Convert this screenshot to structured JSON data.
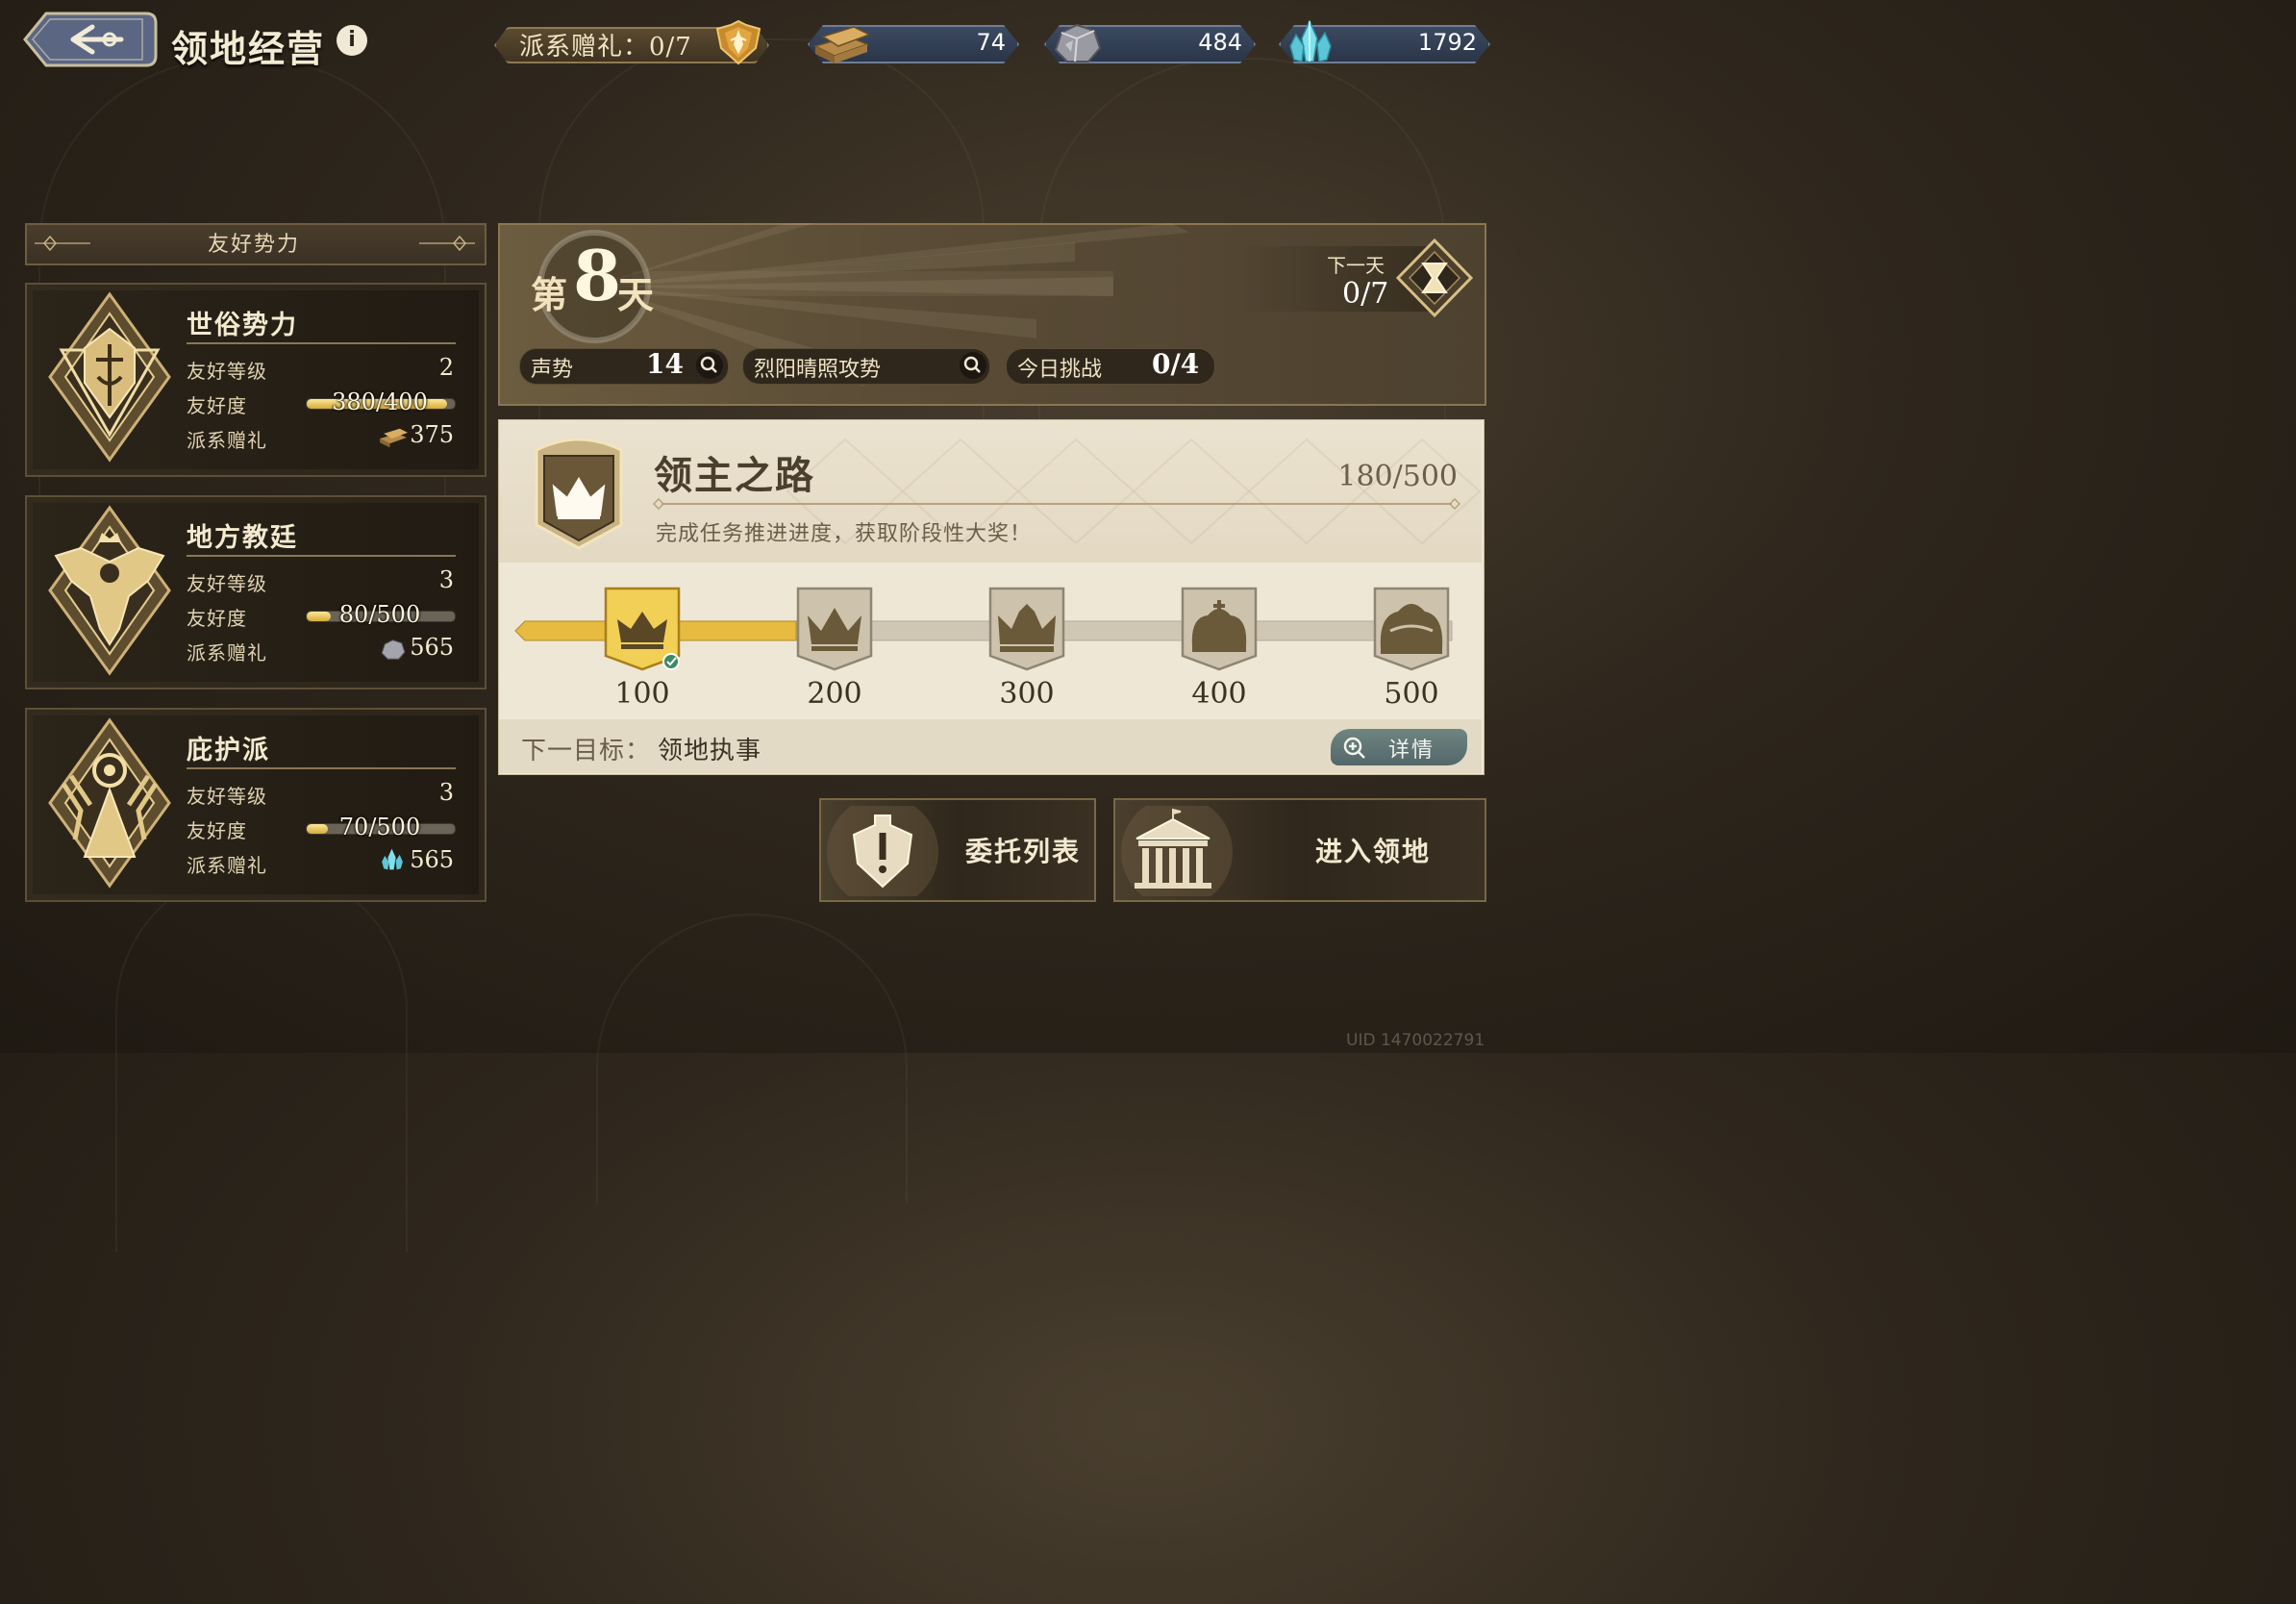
{
  "header": {
    "title": "领地经营",
    "info_label": "i",
    "faction_gift": "派系赠礼：0/7",
    "resources": [
      {
        "name": "wood",
        "icon": "wood-planks-icon",
        "value": "74"
      },
      {
        "name": "ore",
        "icon": "ore-rock-icon",
        "value": "484"
      },
      {
        "name": "crystal",
        "icon": "crystal-icon",
        "value": "1792"
      }
    ]
  },
  "factions": {
    "header": "友好势力",
    "labels": {
      "level": "友好等级",
      "friendship": "友好度",
      "gift": "派系赠礼"
    },
    "items": [
      {
        "name": "世俗势力",
        "level": "2",
        "friendship_text": "380/400",
        "friendship_progress": 0.95,
        "gift_icon": "wood-planks-icon",
        "gift_value": "375"
      },
      {
        "name": "地方教廷",
        "level": "3",
        "friendship_text": "80/500",
        "friendship_progress": 0.16,
        "gift_icon": "ore-rock-icon",
        "gift_value": "565"
      },
      {
        "name": "庇护派",
        "level": "3",
        "friendship_text": "70/500",
        "friendship_progress": 0.14,
        "gift_icon": "crystal-icon",
        "gift_value": "565"
      }
    ]
  },
  "day": {
    "prefix": "第",
    "number": "8",
    "suffix": "天",
    "next_day_label": "下一天",
    "next_day_count": "0/7",
    "stats": [
      {
        "label": "声势",
        "value": "14"
      },
      {
        "label": "烈阳晴照攻势",
        "value": ""
      },
      {
        "label": "今日挑战",
        "value": "0/4"
      }
    ]
  },
  "lord_road": {
    "title": "领主之路",
    "progress": "180/500",
    "progress_value": 180,
    "description": "完成任务推进进度，获取阶段性大奖！",
    "milestones": [
      {
        "value": "100",
        "reached": true
      },
      {
        "value": "200",
        "reached": false
      },
      {
        "value": "300",
        "reached": false
      },
      {
        "value": "400",
        "reached": false
      },
      {
        "value": "500",
        "reached": false
      }
    ],
    "next_goal_label": "下一目标：",
    "next_goal_value": "领地执事",
    "detail_label": "详情"
  },
  "actions": {
    "commission_list": "委托列表",
    "enter_territory": "进入领地"
  },
  "uid": "UID 1470022791",
  "colors": {
    "gold": "#e2b84a",
    "panel_dark": "#2b2419",
    "accent_teal": "#5f7577"
  }
}
